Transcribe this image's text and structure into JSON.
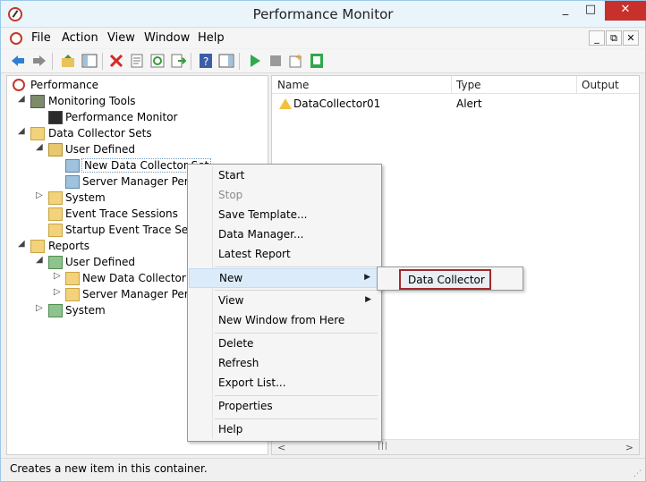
{
  "window": {
    "title": "Performance Monitor",
    "min": "_",
    "max": "□",
    "close": "✕"
  },
  "menu": {
    "items": [
      "File",
      "Action",
      "View",
      "Window",
      "Help"
    ],
    "mdi_min": "_",
    "mdi_restore": "⧉",
    "mdi_close": "✕"
  },
  "toolbar": {
    "icons": [
      "back-icon",
      "forward-icon",
      "up-folder-icon",
      "show-hide-console-tree-icon",
      "delete-icon",
      "properties-icon",
      "refresh-icon",
      "export-list-icon",
      "help-icon",
      "action-pane-icon",
      "start-icon",
      "stop-icon",
      "new-icon",
      "latest-report-icon"
    ]
  },
  "tree": {
    "performance": "Performance",
    "monitoring_tools": "Monitoring Tools",
    "performance_monitor": "Performance Monitor",
    "data_collector_sets": "Data Collector Sets",
    "user_defined": "User Defined",
    "new_data_collector_set": "New Data Collector Set",
    "server_manager_perf": "Server Manager Perform",
    "system": "System",
    "event_trace_sessions": "Event Trace Sessions",
    "startup_event_trace": "Startup Event Trace Sessio",
    "reports": "Reports",
    "reports_user_defined": "User Defined",
    "reports_new_dcs": "New Data Collector Se",
    "reports_server_manager": "Server Manager Perfor",
    "reports_system": "System"
  },
  "list": {
    "columns": [
      "Name",
      "Type",
      "Output"
    ],
    "rows": [
      {
        "name": "DataCollector01",
        "type": "Alert",
        "output": ""
      }
    ]
  },
  "context_menu": {
    "start": "Start",
    "stop": "Stop",
    "save_template": "Save Template...",
    "data_manager": "Data Manager...",
    "latest_report": "Latest Report",
    "new": "New",
    "view": "View",
    "new_window": "New Window from Here",
    "delete": "Delete",
    "refresh": "Refresh",
    "export_list": "Export List...",
    "properties": "Properties",
    "help": "Help"
  },
  "submenu": {
    "data_collector": "Data Collector"
  },
  "status": {
    "text": "Creates a new item in this container."
  },
  "colors": {
    "highlight_border": "#a12a2a",
    "menu_hover": "#dcebfa",
    "close_button": "#c7302b"
  }
}
